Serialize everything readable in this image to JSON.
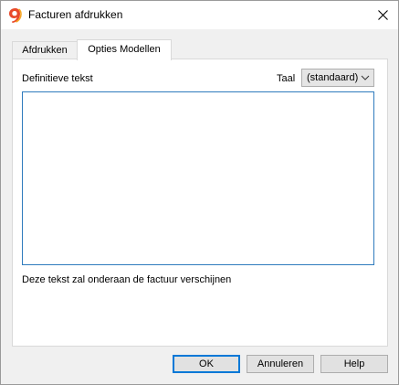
{
  "window": {
    "title": "Facturen afdrukken",
    "app_icon": "banana-app-icon",
    "close_icon": "close-icon"
  },
  "tabs": [
    {
      "label": "Afdrukken",
      "active": false
    },
    {
      "label": "Opties Modellen",
      "active": true
    }
  ],
  "panel": {
    "text_label": "Definitieve tekst",
    "language_label": "Taal",
    "language_value": "(standaard)",
    "text_value": "",
    "hint": "Deze tekst zal onderaan de factuur verschijnen"
  },
  "buttons": {
    "ok": "OK",
    "cancel": "Annuleren",
    "help": "Help"
  },
  "colors": {
    "focus": "#0078d7",
    "textarea_border": "#2f7bbd",
    "app_icon": "#e8492a"
  }
}
